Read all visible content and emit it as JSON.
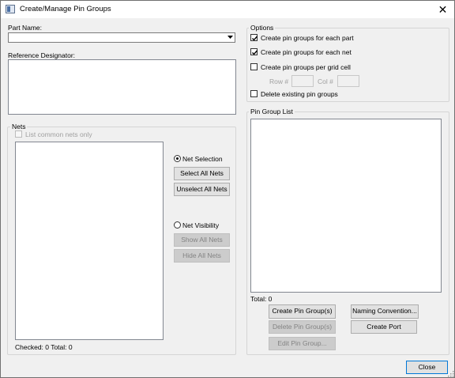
{
  "window": {
    "title": "Create/Manage Pin Groups"
  },
  "part_name": {
    "label": "Part Name:",
    "value": ""
  },
  "reference_designator": {
    "label": "Reference Designator:",
    "value": ""
  },
  "options": {
    "title": "Options",
    "create_per_part": "Create pin groups for each part",
    "create_per_part_checked": true,
    "create_per_net": "Create pin groups for each net",
    "create_per_net_checked": true,
    "create_per_grid": "Create pin groups per grid cell",
    "create_per_grid_checked": false,
    "row_label": "Row #",
    "row_value": "",
    "col_label": "Col #",
    "col_value": "",
    "delete_existing": "Delete existing pin groups",
    "delete_existing_checked": false
  },
  "nets": {
    "title": "Nets",
    "list_common": "List common nets only",
    "net_selection": "Net Selection",
    "select_all": "Select All Nets",
    "unselect_all": "Unselect All Nets",
    "net_visibility": "Net Visibility",
    "show_all": "Show All Nets",
    "hide_all": "Hide All Nets",
    "status": "Checked: 0 Total: 0"
  },
  "pin_group_list": {
    "title": "Pin Group List",
    "total": "Total: 0",
    "create": "Create Pin Group(s)",
    "naming": "Naming Convention...",
    "delete": "Delete Pin Group(s)",
    "create_port": "Create Port",
    "edit": "Edit Pin Group..."
  },
  "close_button": "Close",
  "colors": {
    "accent": "#0078d7",
    "dialog_bg": "#f0f0f0",
    "disabled_text": "#a0a0a0"
  },
  "icons": [
    "app-icon",
    "close-icon",
    "dropdown-arrow-icon",
    "checkmark-icon",
    "radio-dot-icon",
    "size-grip-icon"
  ]
}
